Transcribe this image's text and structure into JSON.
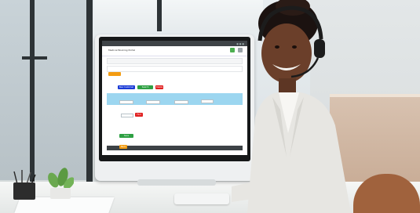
{
  "screen": {
    "app_title": "Medical Booking Portal",
    "buttons": {
      "new": "New Customer",
      "search": "Search",
      "delete": "Delete",
      "find": "Find",
      "save": "Save",
      "back": "Back"
    },
    "colors": {
      "titlebar": "#3e4347",
      "header_green": "#4caf50",
      "orange": "#f39c12",
      "blue_band": "#9cd6f0",
      "blue_btn": "#1a3bd6",
      "green_btn": "#2ea043",
      "red_btn": "#e02020"
    }
  },
  "scene": {
    "subject": "headset",
    "objects": [
      "monitor",
      "keyboard",
      "pen-holder",
      "plant",
      "paper"
    ]
  }
}
